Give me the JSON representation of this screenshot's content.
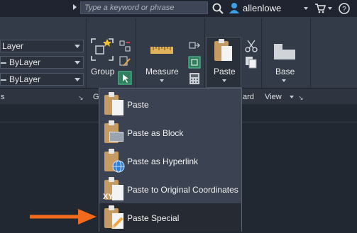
{
  "titlebar": {
    "search_placeholder": "Type a keyword or phrase",
    "user_name": "allenlowe",
    "icons": [
      "search-icon",
      "user-icon",
      "cart-icon",
      "help-icon"
    ]
  },
  "ribbon": {
    "layer_combo": "Layer",
    "linetype_combo": "ByLayer",
    "lineweight_combo": "ByLayer",
    "group_label": "Group",
    "measure_label": "Measure",
    "paste_label": "Paste",
    "base_label": "Base",
    "panel_labels": {
      "properties": "s",
      "groups": "G",
      "clipboard": "ard",
      "view": "View"
    }
  },
  "paste_menu": {
    "items": [
      {
        "label": "Paste",
        "icon": "paste-icon"
      },
      {
        "label": "Paste as Block",
        "icon": "paste-as-block-icon"
      },
      {
        "label": "Paste as Hyperlink",
        "icon": "paste-as-hyperlink-icon"
      },
      {
        "label": "Paste to Original Coordinates",
        "icon": "paste-to-original-coordinates-icon",
        "badge": "XY"
      },
      {
        "label": "Paste Special",
        "icon": "paste-special-icon",
        "highlighted": true
      }
    ]
  },
  "annotation": {
    "arrow_color": "#f26b1d"
  },
  "colors": {
    "ribbon_bg": "#343b48",
    "menu_bg": "#3b4352",
    "highlight_bg": "#252a33",
    "clipboard_brown": "#c69a63"
  }
}
